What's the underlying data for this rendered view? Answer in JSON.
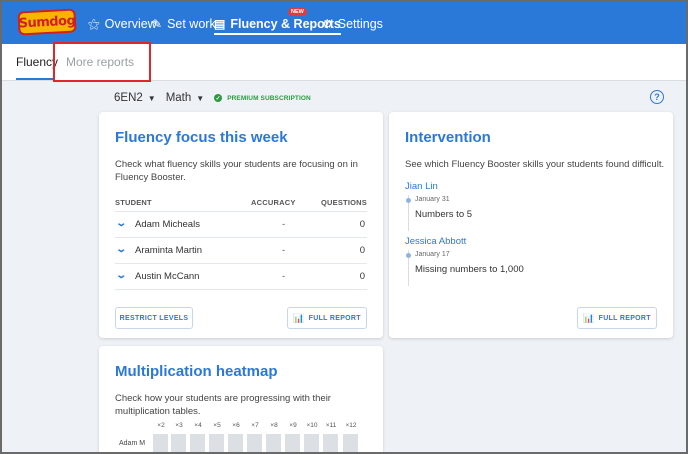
{
  "nav": {
    "logo": "Sumdog",
    "items": [
      {
        "label": "Overview",
        "icon": "group-icon"
      },
      {
        "label": "Set work",
        "icon": "pencil-icon"
      },
      {
        "label": "Fluency & Reports",
        "icon": "chart-icon",
        "badge": "NEW"
      },
      {
        "label": "Settings",
        "icon": "gears-icon"
      }
    ]
  },
  "subnav": {
    "tabs": [
      "Fluency",
      "More reports"
    ]
  },
  "classbar": {
    "class_name": "6EN2",
    "subject": "Math",
    "subscription": "PREMIUM SUBSCRIPTION"
  },
  "fluency": {
    "title": "Fluency focus this week",
    "description": "Check what fluency skills your students are focusing on in Fluency Booster.",
    "columns": [
      "STUDENT",
      "ACCURACY",
      "QUESTIONS"
    ],
    "rows": [
      {
        "name": "Adam Micheals",
        "accuracy": "-",
        "questions": "0"
      },
      {
        "name": "Araminta Martin",
        "accuracy": "-",
        "questions": "0"
      },
      {
        "name": "Austin McCann",
        "accuracy": "-",
        "questions": "0"
      }
    ],
    "restrict_label": "RESTRICT LEVELS",
    "full_report_label": "FULL REPORT"
  },
  "intervention": {
    "title": "Intervention",
    "description": "See which Fluency Booster skills your students found difficult.",
    "entries": [
      {
        "student": "Jian Lin",
        "date": "January 31",
        "task": "Numbers to 5"
      },
      {
        "student": "Jessica Abbott",
        "date": "January 17",
        "task": "Missing numbers to 1,000"
      }
    ],
    "full_report_label": "FULL REPORT"
  },
  "heatmap": {
    "title": "Multiplication heatmap",
    "description": "Check how your students are progressing with their multiplication tables.",
    "columns": [
      "×2",
      "×3",
      "×4",
      "×5",
      "×6",
      "×7",
      "×8",
      "×9",
      "×10",
      "×11",
      "×12"
    ],
    "row_label": "Adam M"
  }
}
